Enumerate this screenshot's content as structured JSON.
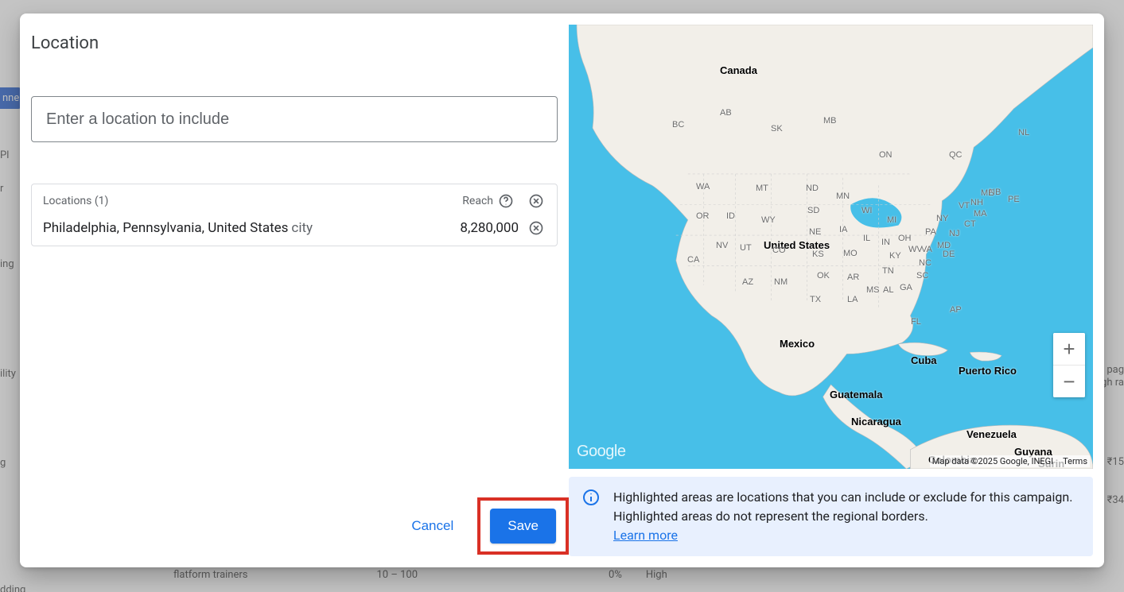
{
  "background": {
    "sidebar_nne": "nne",
    "sidebar_items": [
      "Pl",
      "r",
      "ing",
      "ility",
      "g",
      "dding"
    ],
    "table": {
      "keyword1": "flatform trainers",
      "volume1": "10 – 100",
      "pct1": "0%",
      "comp1": "High",
      "pagelabel": "pag",
      "ghra": "gh ra",
      "price1": "₹15",
      "price2": "₹34"
    }
  },
  "dialog": {
    "title": "Location",
    "input_placeholder": "Enter a location to include",
    "locations_label": "Locations (1)",
    "reach_label": "Reach",
    "location_name": "Philadelphia, Pennsylvania, United States",
    "location_type": "city",
    "location_reach": "8,280,000",
    "cancel": "Cancel",
    "save": "Save"
  },
  "map": {
    "countries": {
      "ca": "Canada",
      "us": "United States",
      "mx": "Mexico",
      "cu": "Cuba",
      "pr": "Puerto Rico",
      "gt": "Guatemala",
      "ni": "Nicaragua",
      "co": "Colombia",
      "ve": "Venezuela",
      "gy": "Guyana",
      "sr": "Surin"
    },
    "provinces": {
      "bc": "BC",
      "ab": "AB",
      "sk": "SK",
      "mb": "MB",
      "on": "ON",
      "qc": "QC",
      "nl": "NL",
      "nb": "NB",
      "pe": "PE"
    },
    "states": {
      "wa": "WA",
      "or": "OR",
      "ca": "CA",
      "nv": "NV",
      "id": "ID",
      "mt": "MT",
      "wy": "WY",
      "ut": "UT",
      "az": "AZ",
      "nm": "NM",
      "co": "CO",
      "nd": "ND",
      "sd": "SD",
      "ne": "NE",
      "ks": "KS",
      "ok": "OK",
      "tx": "TX",
      "mn": "MN",
      "ia": "IA",
      "mo": "MO",
      "ar": "AR",
      "la": "LA",
      "wi": "WI",
      "il": "IL",
      "mi": "MI",
      "in": "IN",
      "oh": "OH",
      "ky": "KY",
      "tn": "TN",
      "ms": "MS",
      "al": "AL",
      "ga": "GA",
      "fl": "FL",
      "sc": "SC",
      "nc": "NC",
      "va": "VA",
      "wv": "WV",
      "pa": "PA",
      "ny": "NY",
      "md": "MD",
      "de": "DE",
      "nj": "NJ",
      "ct": "CT",
      "ma": "MA",
      "vt": "VT",
      "nh": "NH",
      "me": "ME",
      "ap": "AP"
    },
    "attribution": "Map data ©2025 Google, INEGI",
    "terms": "Terms",
    "logo": "Google"
  },
  "info": {
    "text": "Highlighted areas are locations that you can include or exclude for this campaign. Highlighted areas do not represent the regional borders.",
    "learn_more": "Learn more"
  }
}
